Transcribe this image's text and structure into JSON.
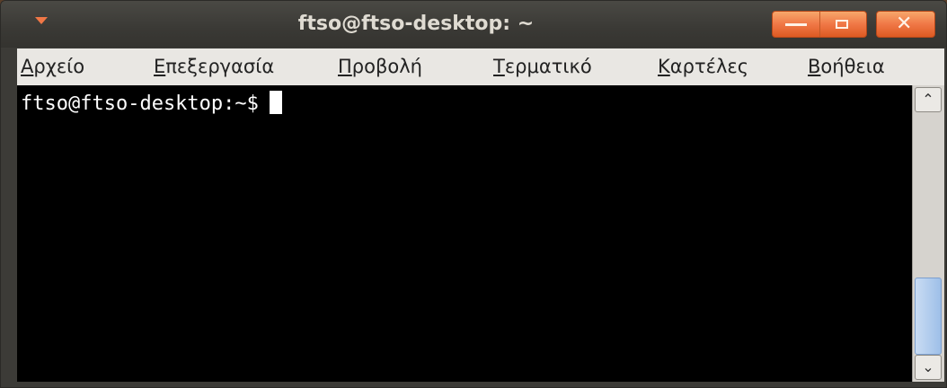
{
  "window": {
    "title": "ftso@ftso-desktop: ~"
  },
  "titlebar_buttons": {
    "minimize": "—",
    "maximize": "□",
    "close": "✕"
  },
  "menu": {
    "items": [
      {
        "mnemonic": "Α",
        "rest": "ρχείο"
      },
      {
        "mnemonic": "Ε",
        "rest": "πεξεργασία"
      },
      {
        "mnemonic": "Π",
        "rest": "ροβολή"
      },
      {
        "mnemonic": "Τ",
        "rest": "ερματικό"
      },
      {
        "mnemonic": "Κ",
        "rest": "αρτέλες"
      },
      {
        "mnemonic": "Β",
        "rest": "οήθεια"
      }
    ]
  },
  "terminal": {
    "prompt": "ftso@ftso-desktop:~$"
  },
  "scrollbar": {
    "up_glyph": "⌃",
    "down_glyph": "⌄"
  },
  "colors": {
    "accent": "#f07746",
    "terminal_bg": "#000000",
    "terminal_fg": "#ffffff",
    "menubar_bg": "#e9e7e3",
    "titlebar_bg": "#3c3b37"
  }
}
